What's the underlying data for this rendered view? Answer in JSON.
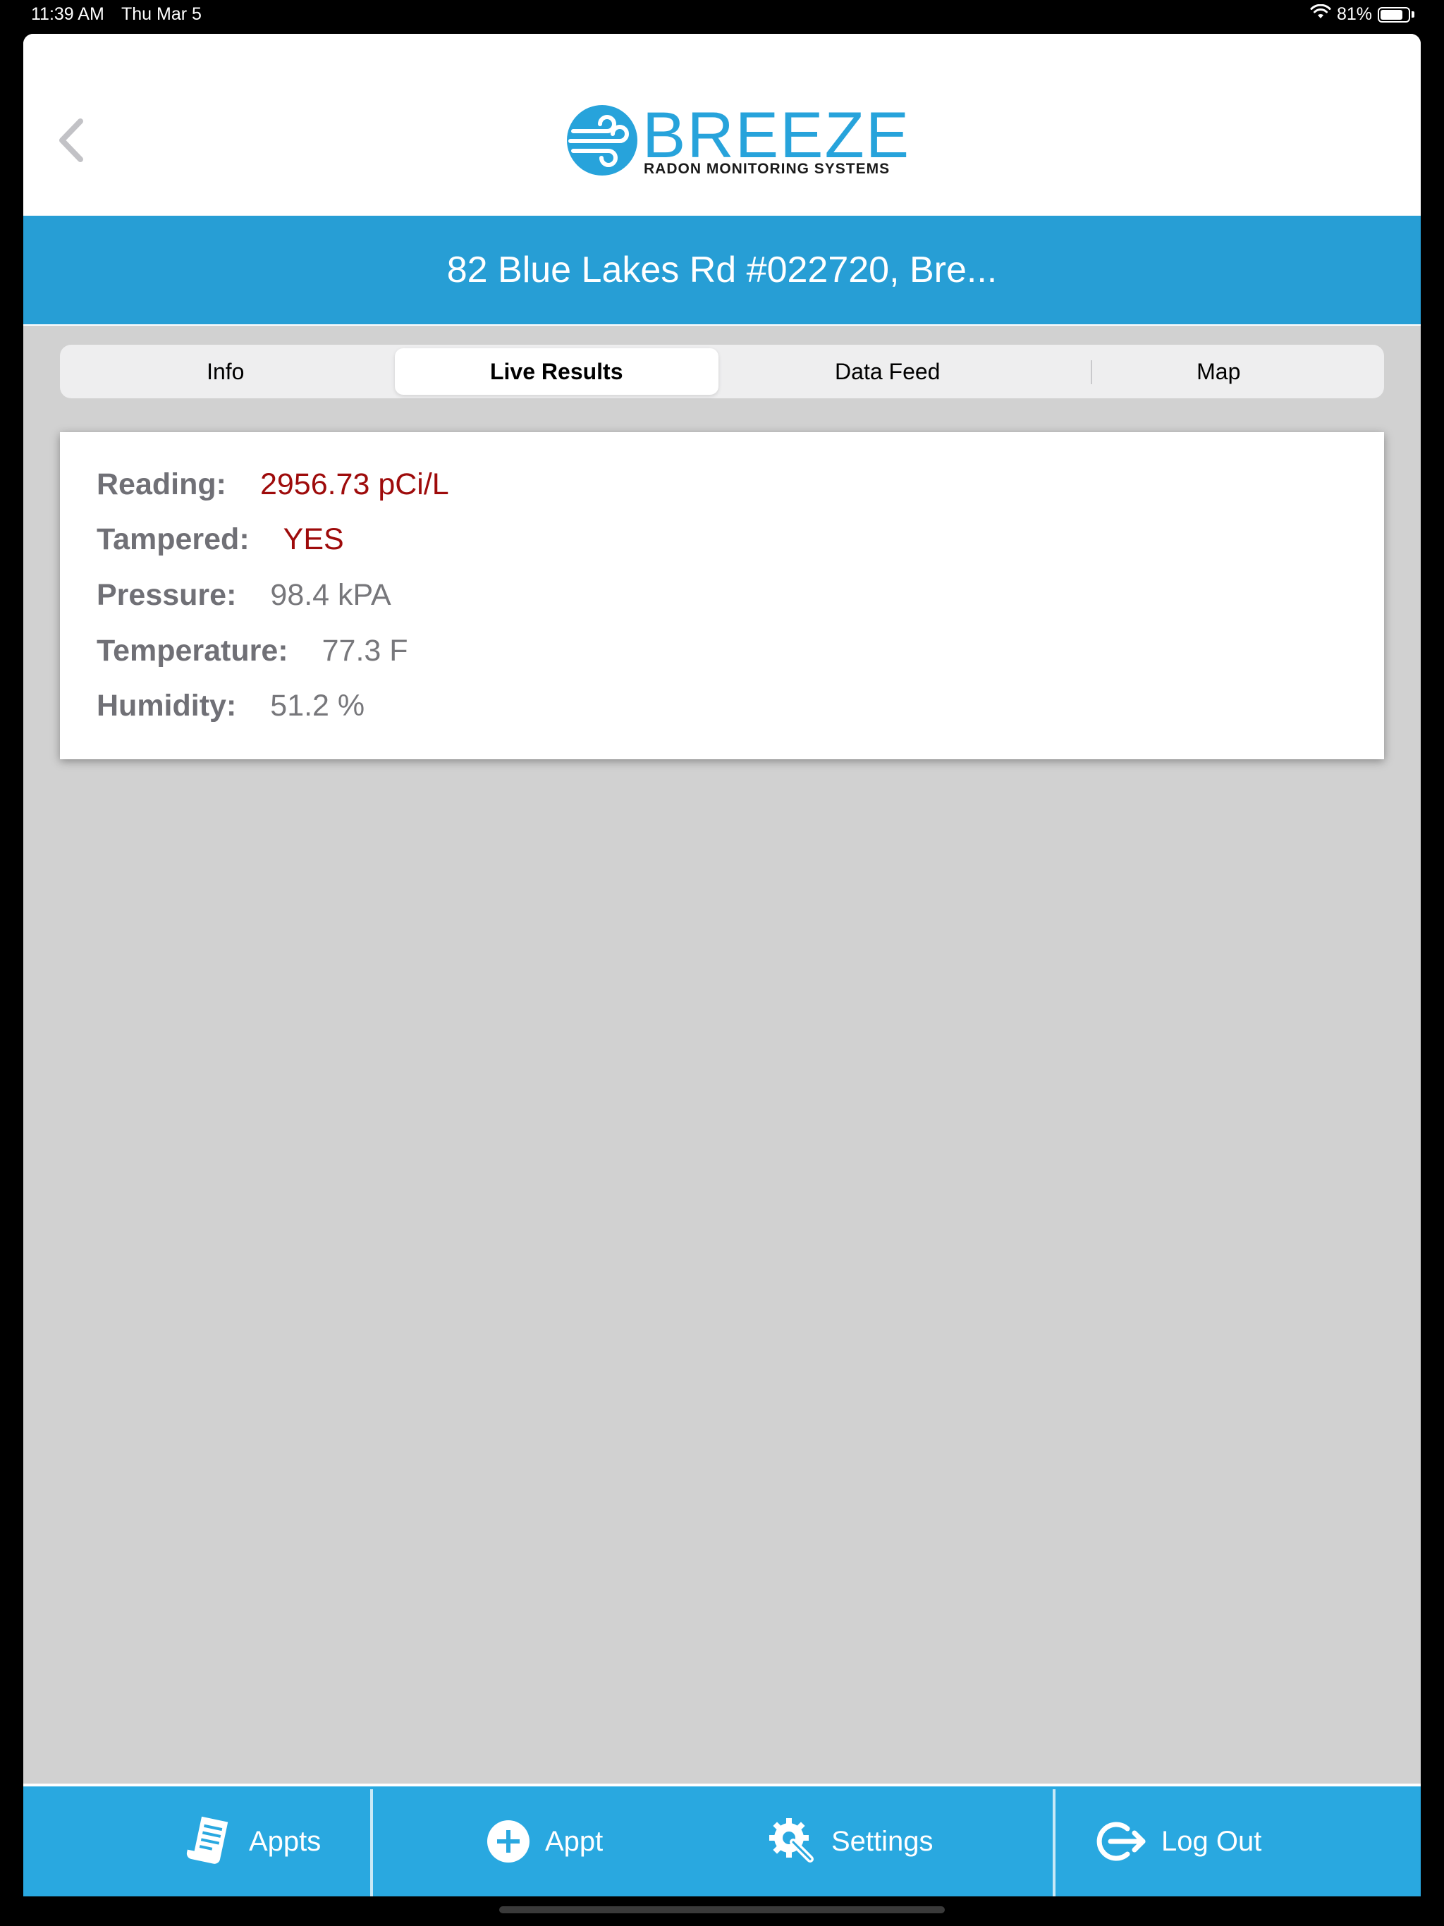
{
  "status_bar": {
    "time": "11:39 AM",
    "date": "Thu Mar 5",
    "battery": "81%",
    "battery_level": 0.81
  },
  "header": {
    "logo_word": "BREEZE",
    "logo_tagline": "RADON MONITORING SYSTEMS",
    "back_icon": "chevron-left-icon"
  },
  "title_bar": {
    "title": "82 Blue Lakes Rd #022720, Bre..."
  },
  "tabs": [
    {
      "label": "Info",
      "active": false
    },
    {
      "label": "Live Results",
      "active": true
    },
    {
      "label": "Data Feed",
      "active": false
    },
    {
      "label": "Map",
      "active": false
    }
  ],
  "results": {
    "reading": {
      "label": "Reading:",
      "value": "2956.73 pCi/L"
    },
    "tampered": {
      "label": "Tampered:",
      "value": "YES"
    },
    "pressure": {
      "label": "Pressure:",
      "value": "98.4 kPA"
    },
    "temperature": {
      "label": "Temperature:",
      "value": "77.3 F"
    },
    "humidity": {
      "label": "Humidity:",
      "value": "51.2 %"
    }
  },
  "bottom_tabs": [
    {
      "label": "Appts",
      "icon": "document-list-icon"
    },
    {
      "label": "Appt",
      "icon": "plus-circle-icon"
    },
    {
      "label": "Settings",
      "icon": "gear-wrench-icon"
    },
    {
      "label": "Log Out",
      "icon": "logout-icon"
    }
  ],
  "colors": {
    "brand_blue": "#279ed5",
    "tabbar_blue": "#29a8e0",
    "alert_red": "#9e0b0b",
    "background_gray": "#d1d1d1"
  }
}
